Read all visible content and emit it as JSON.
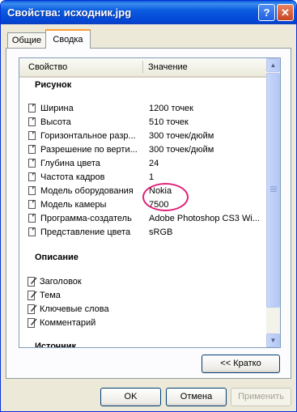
{
  "window": {
    "title": "Свойства: исходник.jpg"
  },
  "title_buttons": {
    "help": "?",
    "close": "✕"
  },
  "tabs": [
    {
      "label": "Общие",
      "active": false
    },
    {
      "label": "Сводка",
      "active": true
    }
  ],
  "list": {
    "columns": {
      "property": "Свойство",
      "value": "Значение"
    },
    "sections": {
      "image": "Рисунок",
      "description": "Описание",
      "source": "Источник"
    },
    "image_rows": [
      {
        "label": "Ширина",
        "value": "1200 точек"
      },
      {
        "label": "Высота",
        "value": "510 точек"
      },
      {
        "label": "Горизонтальное разр...",
        "value": "300 точек/дюйм"
      },
      {
        "label": "Разрешение по верти...",
        "value": "300 точек/дюйм"
      },
      {
        "label": "Глубина цвета",
        "value": "24"
      },
      {
        "label": "Частота кадров",
        "value": "1"
      },
      {
        "label": "Модель оборудования",
        "value": "Nokia"
      },
      {
        "label": "Модель камеры",
        "value": "7500"
      },
      {
        "label": "Программа-создатель",
        "value": "Adobe Photoshop CS3 Wi..."
      },
      {
        "label": "Представление цвета",
        "value": "sRGB"
      }
    ],
    "description_rows": [
      {
        "label": "Заголовок"
      },
      {
        "label": "Тема"
      },
      {
        "label": "Ключевые слова"
      },
      {
        "label": "Комментарий"
      }
    ]
  },
  "scrollbar": {
    "up": "▲",
    "down": "▼"
  },
  "buttons": {
    "brief": "<< Кратко",
    "ok": "OK",
    "cancel": "Отмена",
    "apply": "Применить"
  },
  "colors": {
    "highlight_circle": "#e0207a",
    "title_bar": "#0b5de0"
  }
}
